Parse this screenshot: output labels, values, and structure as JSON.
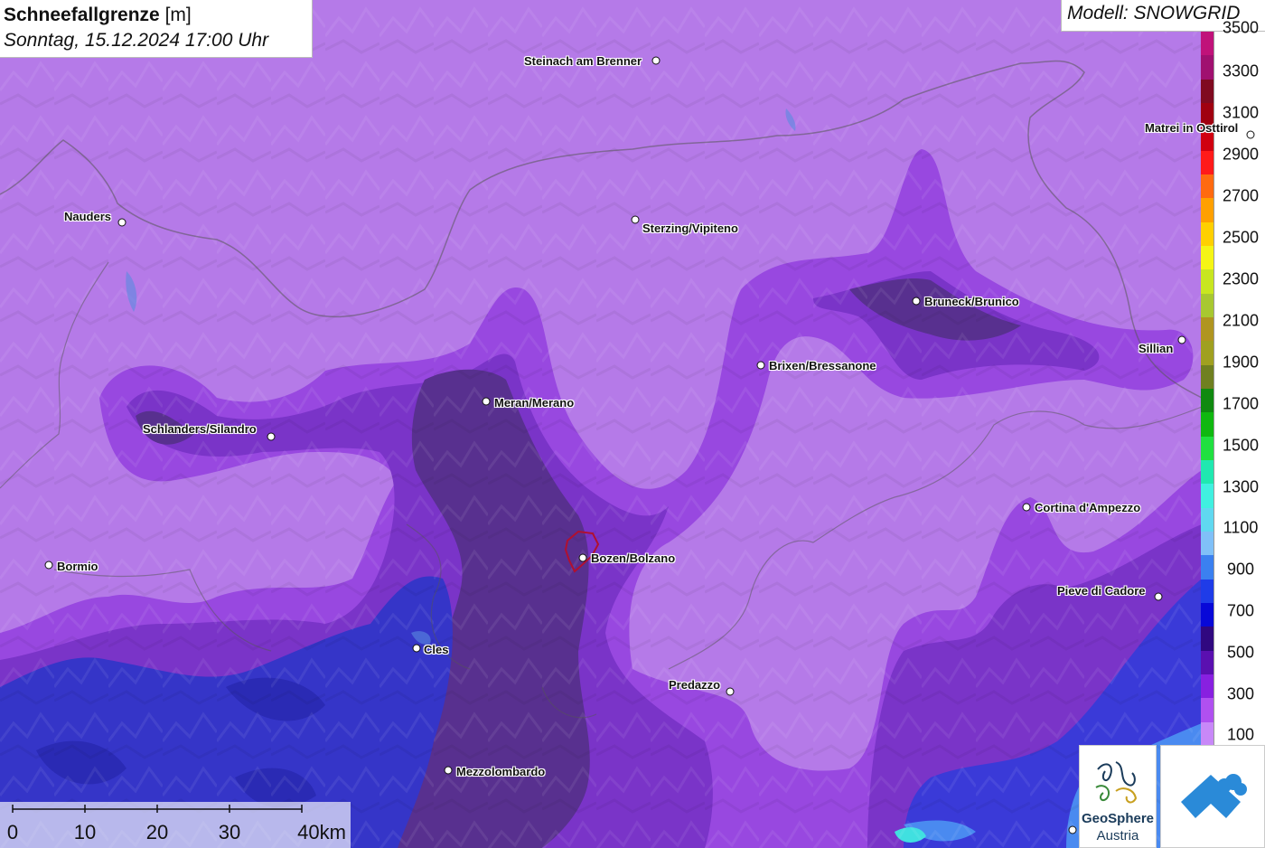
{
  "title": {
    "main": "Schneefallgrenze",
    "unit": "[m]",
    "datetime": "Sonntag, 15.12.2024 17:00 Uhr"
  },
  "model": "Modell: SNOWGRID",
  "legend": {
    "labels": [
      "3500",
      "3300",
      "3100",
      "2900",
      "2700",
      "2500",
      "2300",
      "2100",
      "1900",
      "1700",
      "1500",
      "1300",
      "1100",
      "900",
      "700",
      "500",
      "300",
      "100"
    ],
    "colors": [
      "#c0127a",
      "#a01070",
      "#800a20",
      "#a00010",
      "#d00010",
      "#ff1a1a",
      "#ff6a10",
      "#ffa000",
      "#ffd000",
      "#f5f515",
      "#c8e620",
      "#a8c830",
      "#b09520",
      "#a0a020",
      "#708020",
      "#108a10",
      "#10b810",
      "#20e040",
      "#20e8b0",
      "#40f0e0",
      "#60d8f0",
      "#80c0f8",
      "#3b80f0",
      "#1f3ce8",
      "#0808d8",
      "#300880",
      "#5a10b0",
      "#8820e0",
      "#b050f0",
      "#c888f8"
    ]
  },
  "cities": [
    {
      "name": "Steinach am Brenner"
    },
    {
      "name": "Nauders"
    },
    {
      "name": "Sterzing/Vipiteno"
    },
    {
      "name": "Matrei in Osttirol"
    },
    {
      "name": "Bruneck/Brunico"
    },
    {
      "name": "Sillian"
    },
    {
      "name": "Brixen/Bressanone"
    },
    {
      "name": "Meran/Merano"
    },
    {
      "name": "Schlanders/Silandro"
    },
    {
      "name": "Cortina d'Ampezzo"
    },
    {
      "name": "Bormio"
    },
    {
      "name": "Bozen/Bolzano"
    },
    {
      "name": "Pieve di Cadore"
    },
    {
      "name": "Cles"
    },
    {
      "name": "Predazzo"
    },
    {
      "name": "Mezzolombardo"
    }
  ],
  "scale": {
    "ticks": [
      "0",
      "10",
      "20",
      "30",
      "40km"
    ]
  },
  "logos": {
    "geosphere_line1": "GeoSphere",
    "geosphere_line2": "Austria"
  },
  "colors": {
    "background": "#b57ae8",
    "zone_300": "#8a3ad6",
    "zone_500": "#6a2fb8",
    "zone_dark": "#4a2a90",
    "zone_700": "#3a3ad0",
    "zone_900": "#2828c8"
  }
}
